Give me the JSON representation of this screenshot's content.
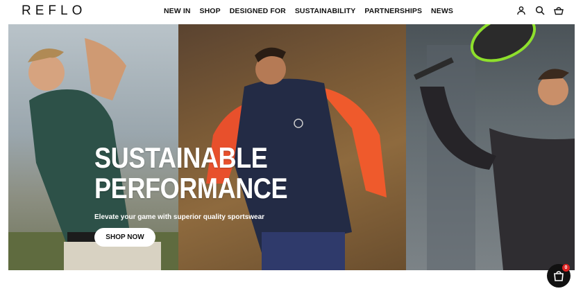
{
  "brand": {
    "logo_text": "REFLO"
  },
  "nav": {
    "items": [
      {
        "label": "NEW IN"
      },
      {
        "label": "SHOP"
      },
      {
        "label": "DESIGNED FOR"
      },
      {
        "label": "SUSTAINABILITY"
      },
      {
        "label": "PARTNERSHIPS"
      },
      {
        "label": "NEWS"
      }
    ]
  },
  "header_icons": [
    "account-icon",
    "search-icon",
    "basket-icon"
  ],
  "hero": {
    "headline_line1": "SUSTAINABLE",
    "headline_line2": "PERFORMANCE",
    "subtitle": "Elevate your game with superior quality sportswear",
    "cta_label": "SHOP NOW",
    "slide_count": 4,
    "active_slide": 1
  },
  "cart": {
    "count": "0"
  },
  "colors": {
    "text": "#111111",
    "cta_bg": "#ffffff",
    "badge": "#dd2222",
    "fab": "#111111"
  }
}
